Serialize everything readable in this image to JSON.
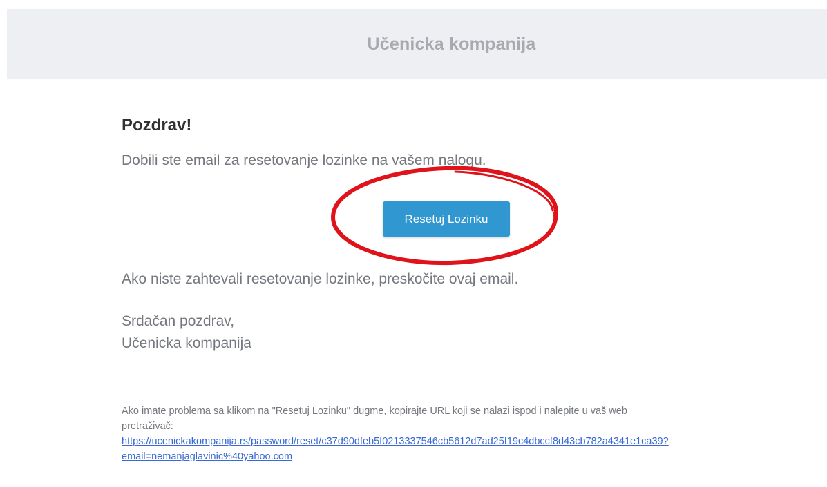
{
  "header": {
    "title": "Učenicka kompanija"
  },
  "body": {
    "greeting": "Pozdrav!",
    "intro": "Dobili ste email za resetovanje lozinke na vašem nalogu.",
    "button_label": "Resetuj Lozinku",
    "notice": "Ako niste zahtevali resetovanje lozinke, preskočite ovaj email.",
    "signoff_line1": "Srdačan pozdrav,",
    "signoff_line2": "Učenicka kompanija"
  },
  "subcopy": {
    "text_line1": "Ako imate problema sa klikom na \"Resetuj Lozinku\" dugme, kopirajte URL koji se nalazi ispod i nalepite u vaš web",
    "text_line2": "pretraživač:",
    "link_line1": "https://ucenickakompanija.rs/password/reset/c37d90dfeb5f0213337546cb5612d7ad25f19c4dbccf8d43cb782a4341e1ca39?",
    "link_line2": "email=nemanjaglavinic%40yahoo.com"
  },
  "colors": {
    "header_bg": "#edeff2",
    "button_bg": "#3097d1",
    "annotation_ellipse": "#e0131b",
    "link": "#3869d4"
  }
}
